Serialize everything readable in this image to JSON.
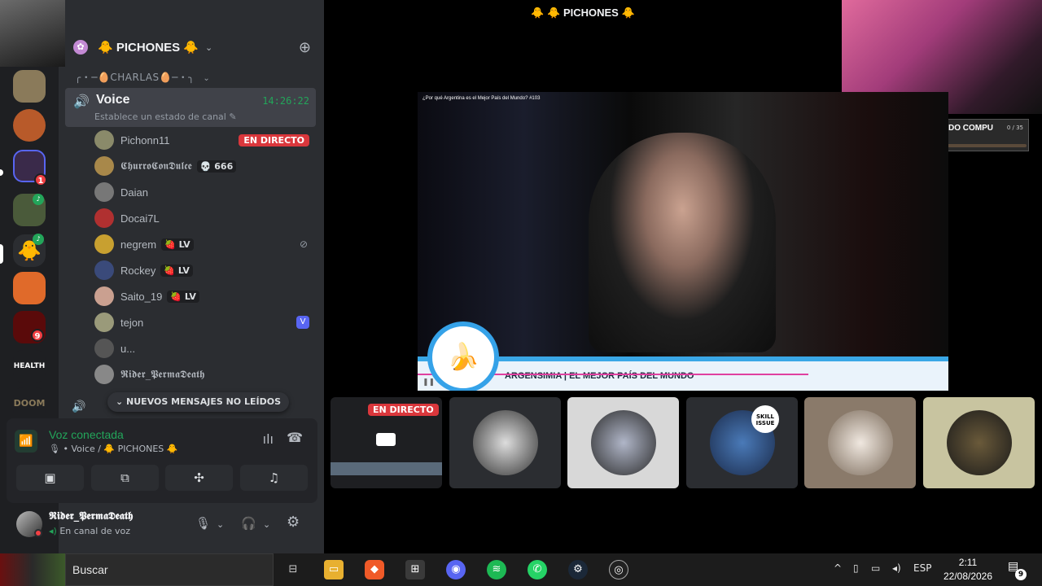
{
  "guild": {
    "name": "🐥 PICHONES 🐥",
    "category": "╭・─🥚CHARLAS🥚─・╮"
  },
  "channel": {
    "name": "Voice",
    "time": "14:26:22",
    "status_placeholder": "Establece un estado de canal"
  },
  "members": [
    {
      "name": "Pichonn11",
      "badge": "EN DIRECTO"
    },
    {
      "name": "𝕮𝖍𝖚𝖗𝖗𝖔𝕮𝖔𝖓𝕯𝖚𝖑𝖈𝖊",
      "tag": "💀 666"
    },
    {
      "name": "Daian"
    },
    {
      "name": "Docai7L"
    },
    {
      "name": "negrem",
      "tag": "🍓 LV"
    },
    {
      "name": "Rockey",
      "tag": "🍓 LV"
    },
    {
      "name": "Saito_19",
      "tag": "🍓 LV"
    },
    {
      "name": "tejon",
      "badge": "V"
    },
    {
      "name": "u..."
    },
    {
      "name": "𝕽𝖎𝖉𝖊𝖗_𝕻𝖊𝖗𝖒𝖆𝕯𝖊𝖆𝖙𝖍"
    }
  ],
  "unread_pill": "⌄ NUEVOS MENSAJES NO LEÍDOS",
  "voice_panel": {
    "title": "Voz conectada",
    "subtitle": "🎙 • Voice / 🐥 PICHONES 🐥"
  },
  "user": {
    "name": "𝕽𝖎𝖉𝖊𝖗_𝕻𝖊𝖗𝖒𝖆𝕯𝖊𝖆𝖙𝖍",
    "status": "En canal de voz"
  },
  "main": {
    "title": "🐥 🐥 PICHONES 🐥",
    "stream_title": "¿Por qué Argentina es el Mejor País del Mundo? #103",
    "stream_lower": "ARGENSIMIA | EL MEJOR PAÍS DEL MUNDO",
    "live_label": "EN DIRECTO",
    "skill": "SKILL ISSUE"
  },
  "monitor": {
    "title": "MONITOR PARA EL GORDO COMPU",
    "count": "0 / 35",
    "percent": "0%",
    "progress": 0
  },
  "rail": {
    "health_label": "HEALTH",
    "doom_label": "DOOM",
    "badge_1": "1",
    "badge_9": "9"
  },
  "taskbar": {
    "search": "Buscar",
    "lang": "ESP",
    "time": "2:11",
    "date": "22/08/2026",
    "notifications": "9"
  },
  "colors": {
    "accent_green": "#23a55a",
    "live_red": "#da373c",
    "sidebar_bg": "#2b2d31"
  }
}
